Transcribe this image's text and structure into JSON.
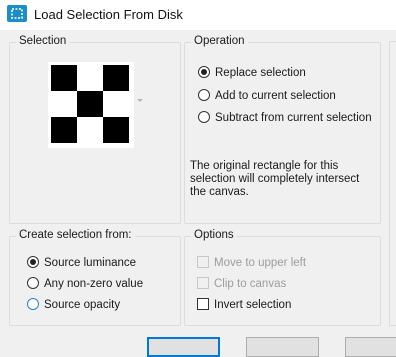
{
  "window": {
    "title": "Load Selection From Disk",
    "icon": "app-icon"
  },
  "selection_group": {
    "legend": "Selection"
  },
  "operation_group": {
    "legend": "Operation",
    "options": [
      {
        "label": "Replace selection",
        "checked": true
      },
      {
        "label": "Add to current selection",
        "checked": false
      },
      {
        "label": "Subtract from current selection",
        "checked": false
      }
    ],
    "info_line1": "The original rectangle for this",
    "info_line2": "selection will completely intersect",
    "info_line3": "the canvas."
  },
  "create_group": {
    "legend": "Create selection from:",
    "options": [
      {
        "label": "Source luminance",
        "checked": true
      },
      {
        "label": "Any non-zero value",
        "checked": false
      },
      {
        "label": "Source opacity",
        "checked": false
      }
    ]
  },
  "options_group": {
    "legend": "Options",
    "items": [
      {
        "label": "Move to upper left",
        "checked": false,
        "enabled": false
      },
      {
        "label": "Clip to canvas",
        "checked": false,
        "enabled": false
      },
      {
        "label": "Invert selection",
        "checked": false,
        "enabled": true
      }
    ]
  },
  "colors": {
    "accent": "#0078d7",
    "icon": "#1b8ec7"
  }
}
